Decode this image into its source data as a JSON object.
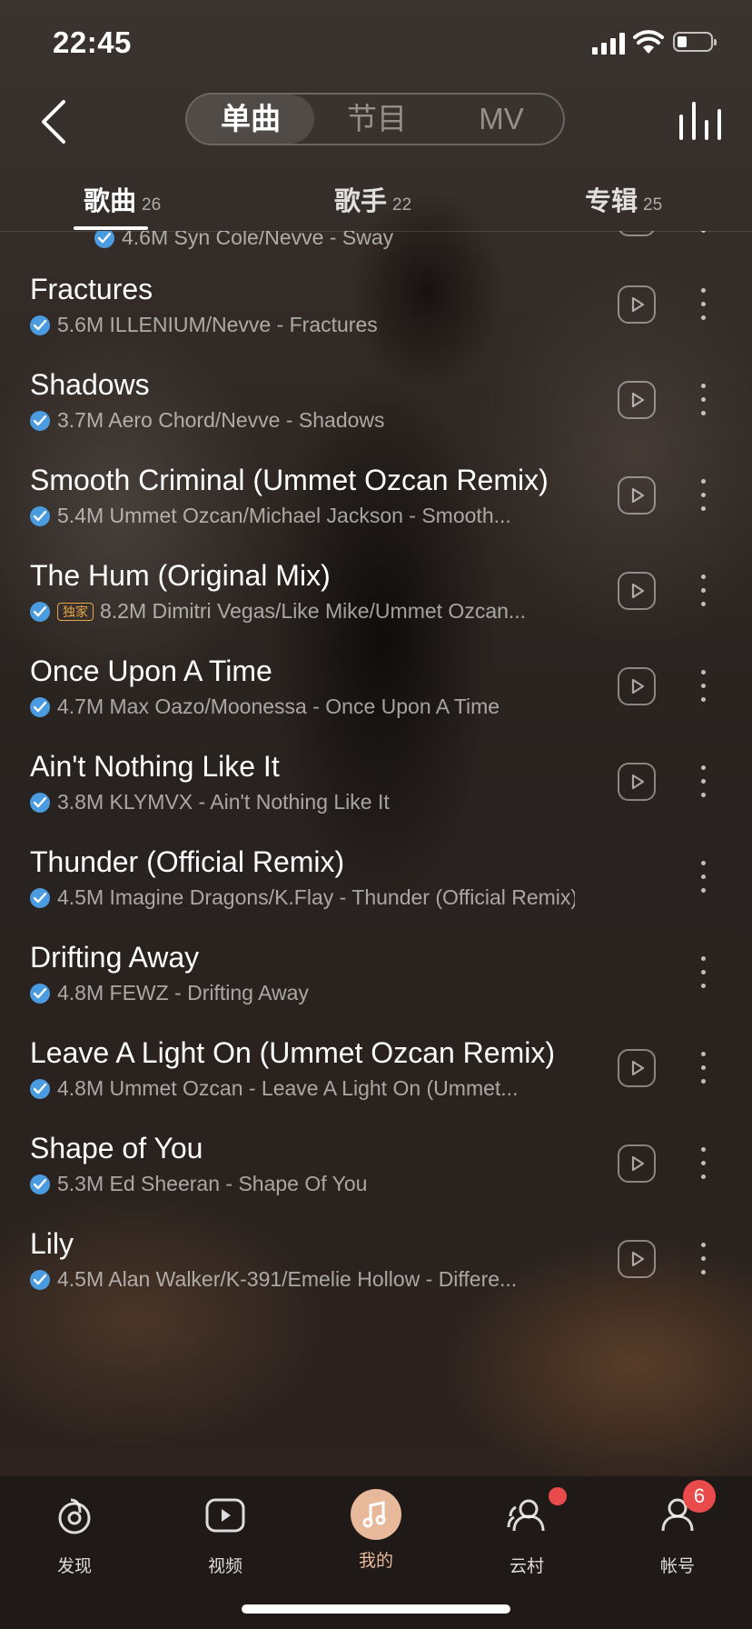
{
  "status_bar": {
    "time": "22:45"
  },
  "segments": [
    {
      "label": "单曲",
      "active": true
    },
    {
      "label": "节目",
      "active": false
    },
    {
      "label": "MV",
      "active": false
    }
  ],
  "subtabs": [
    {
      "label": "歌曲",
      "count": "26",
      "active": true
    },
    {
      "label": "歌手",
      "count": "22",
      "active": false
    },
    {
      "label": "专辑",
      "count": "25",
      "active": false
    }
  ],
  "songs": [
    {
      "title": "",
      "sub": "4.6M Syn Cole/Nevve - Sway",
      "mv": true,
      "partial": true
    },
    {
      "title": "Fractures",
      "sub": "5.6M ILLENIUM/Nevve - Fractures",
      "mv": true
    },
    {
      "title": "Shadows",
      "sub": "3.7M Aero Chord/Nevve - Shadows",
      "mv": true
    },
    {
      "title": "Smooth Criminal (Ummet Ozcan Remix)",
      "sub": "5.4M Ummet Ozcan/Michael Jackson - Smooth...",
      "mv": true
    },
    {
      "title": "The Hum (Original Mix)",
      "sub": "8.2M Dimitri Vegas/Like Mike/Ummet Ozcan...",
      "tag": "独家",
      "mv": true
    },
    {
      "title": "Once Upon A Time",
      "sub": "4.7M Max Oazo/Moonessa - Once Upon A Time",
      "mv": true
    },
    {
      "title": "Ain't Nothing Like It",
      "sub": "3.8M KLYMVX - Ain't Nothing Like It",
      "mv": true
    },
    {
      "title": "Thunder (Official Remix)",
      "sub": "4.5M Imagine Dragons/K.Flay - Thunder (Official Remix)",
      "mv": false
    },
    {
      "title": "Drifting Away",
      "sub": "4.8M FEWZ - Drifting Away",
      "mv": false
    },
    {
      "title": "Leave A Light On (Ummet Ozcan Remix)",
      "sub": "4.8M Ummet Ozcan - Leave A Light On (Ummet...",
      "mv": true
    },
    {
      "title": "Shape of You",
      "sub": "5.3M Ed Sheeran - Shape Of You",
      "mv": true
    },
    {
      "title": "Lily",
      "sub": "4.5M Alan Walker/K-391/Emelie Hollow - Differe...",
      "mv": true
    }
  ],
  "tabbar": [
    {
      "label": "发现",
      "icon": "discover-icon"
    },
    {
      "label": "视频",
      "icon": "video-icon"
    },
    {
      "label": "我的",
      "icon": "music-note-icon",
      "active": true
    },
    {
      "label": "云村",
      "icon": "friends-icon"
    },
    {
      "label": "帐号",
      "icon": "account-icon",
      "badge": "6"
    }
  ],
  "colors": {
    "accent": "#e8b89a",
    "verified": "#4a9be0",
    "badge": "#e94b4b",
    "exclusive_tag": "#e8a64a"
  }
}
